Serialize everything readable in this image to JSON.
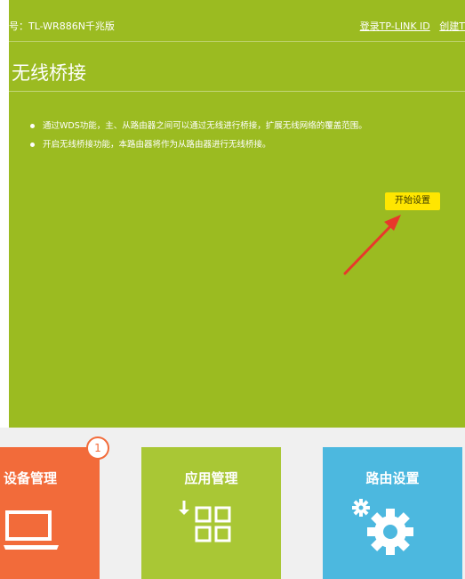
{
  "header": {
    "model_text": "号：TL-WR886N千兆版",
    "login_link": "登录TP-LINK ID",
    "create_link": "创建T"
  },
  "main": {
    "title": "无线桥接",
    "description": [
      "通过WDS功能，主、从路由器之间可以通过无线进行桥接，扩展无线网络的覆盖范围。",
      "开启无线桥接功能，本路由器将作为从路由器进行无线桥接。"
    ],
    "start_button": "开始设置"
  },
  "tiles": {
    "device": {
      "label": "设备管理",
      "badge": "1",
      "icon": "laptop-icon"
    },
    "app": {
      "label": "应用管理",
      "icon": "apps-grid-icon"
    },
    "router": {
      "label": "路由设置",
      "icon": "gear-icon"
    }
  },
  "colors": {
    "panel_green": "#9bbb21",
    "device_orange": "#f26b3a",
    "app_green": "#a9c735",
    "router_blue": "#4cb8df",
    "button_yellow": "#ffe600",
    "annotation_red": "#e8382b"
  }
}
